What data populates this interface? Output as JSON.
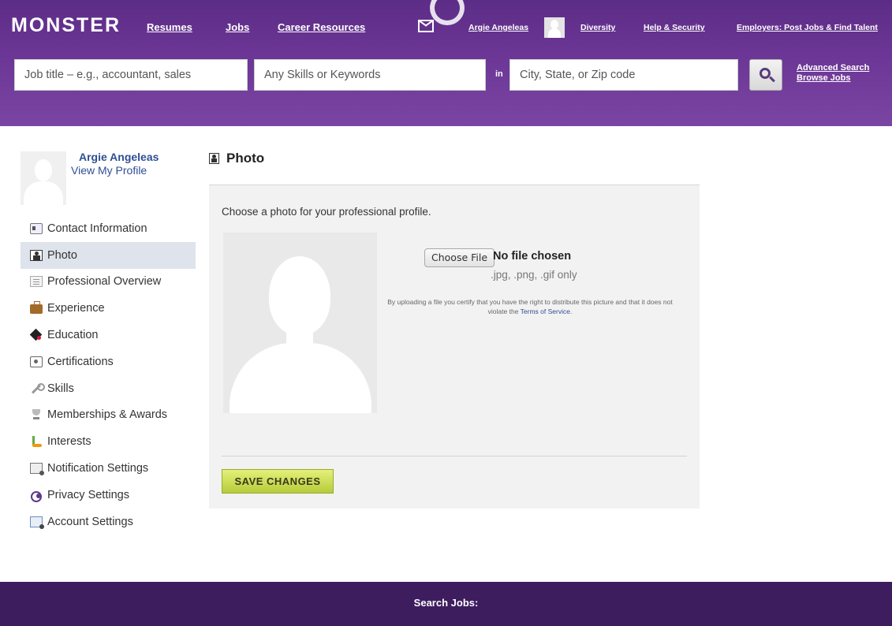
{
  "header": {
    "logo": "MONSTER",
    "nav": {
      "resumes": "Resumes",
      "jobs": "Jobs",
      "career_resources": "Career Resources",
      "user_name": "Argie Angeleas",
      "diversity": "Diversity",
      "help_security": "Help & Security",
      "employers": "Employers: Post Jobs & Find Talent"
    },
    "search": {
      "job_title_placeholder": "Job title – e.g., accountant, sales",
      "skills_placeholder": "Any Skills or Keywords",
      "in_label": "in",
      "location_placeholder": "City, State, or Zip code",
      "advanced_search": "Advanced Search",
      "browse_jobs": "Browse Jobs"
    }
  },
  "sidebar": {
    "profile_name": "Argie Angeleas",
    "view_profile": "View My Profile",
    "items": [
      {
        "label": "Contact Information",
        "icon": "contact-card-icon"
      },
      {
        "label": "Photo",
        "icon": "photo-icon",
        "active": true
      },
      {
        "label": "Professional Overview",
        "icon": "document-icon"
      },
      {
        "label": "Experience",
        "icon": "briefcase-icon"
      },
      {
        "label": "Education",
        "icon": "graduation-cap-icon"
      },
      {
        "label": "Certifications",
        "icon": "certificate-icon"
      },
      {
        "label": "Skills",
        "icon": "wrench-icon"
      },
      {
        "label": "Memberships & Awards",
        "icon": "trophy-icon"
      },
      {
        "label": "Interests",
        "icon": "golf-flag-icon"
      },
      {
        "label": "Notification Settings",
        "icon": "notification-icon"
      },
      {
        "label": "Privacy Settings",
        "icon": "privacy-icon"
      },
      {
        "label": "Account Settings",
        "icon": "account-icon"
      }
    ]
  },
  "main": {
    "title": "Photo",
    "intro": "Choose a photo for your professional profile.",
    "choose_file": "Choose File",
    "no_file": "No file chosen",
    "file_types": ".jpg, .png, .gif only",
    "disclaimer_part1": "By uploading a file you certify that you have the right to distribute this picture and that it does not violate the",
    "terms_link": "Terms of Service",
    "save_button": "SAVE CHANGES"
  },
  "footer": {
    "label": "Search Jobs:"
  }
}
